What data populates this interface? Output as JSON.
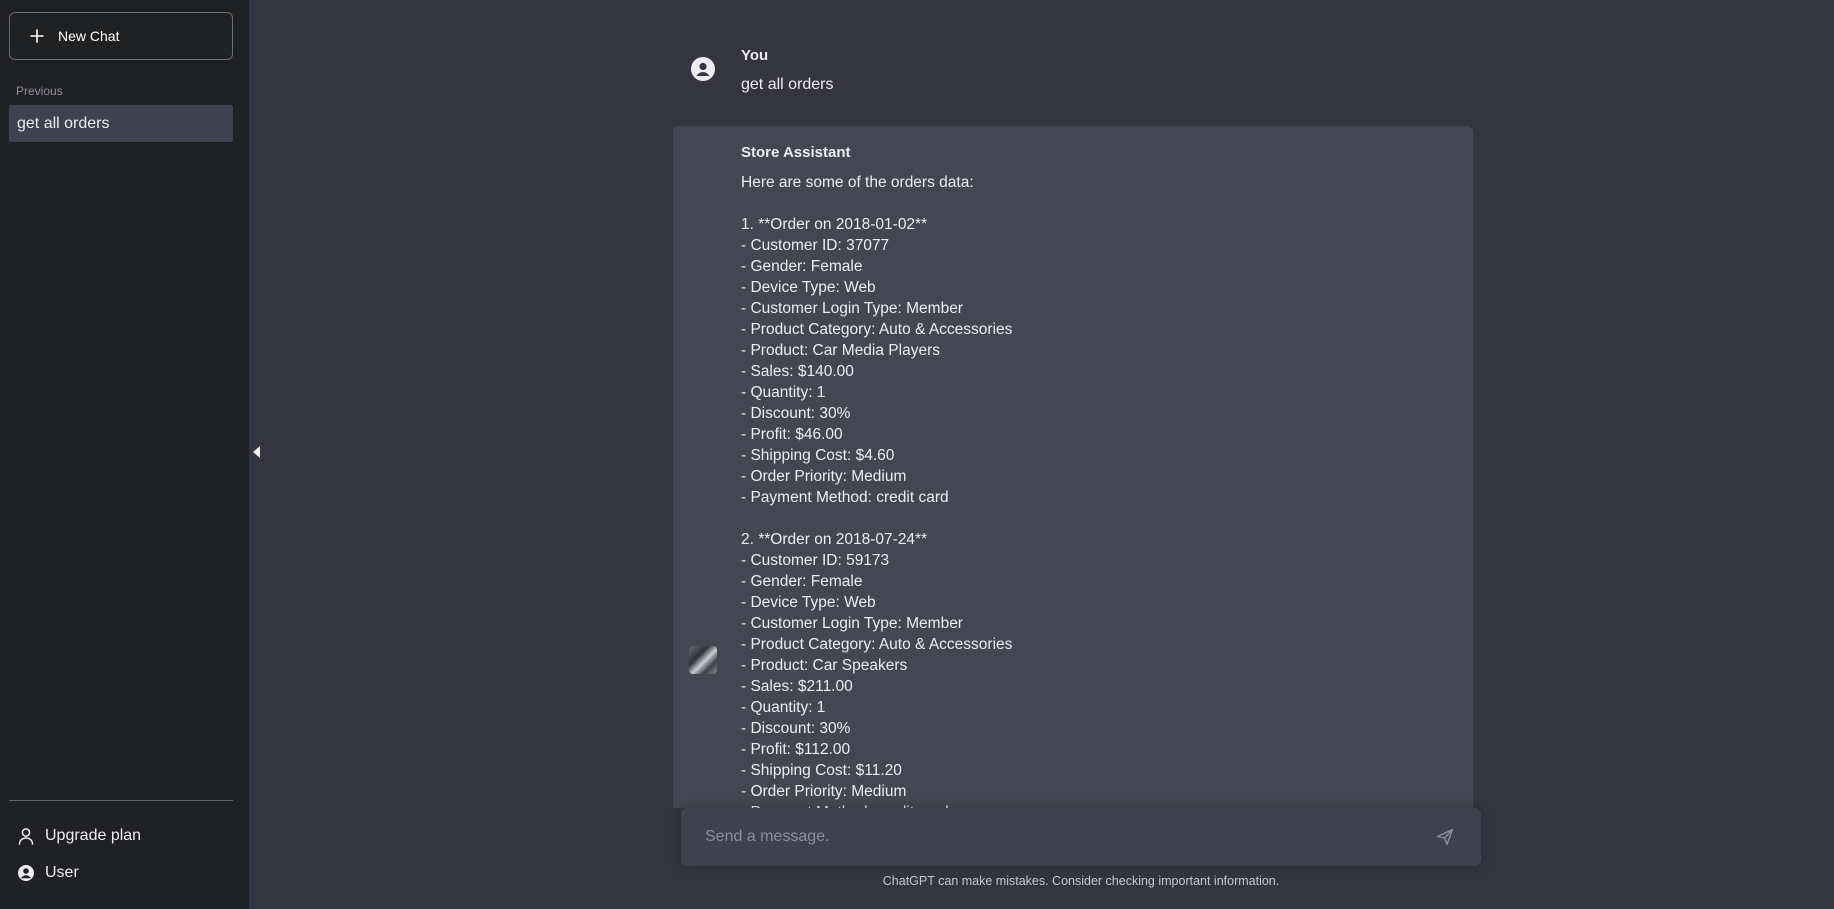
{
  "sidebar": {
    "new_chat_label": "New Chat",
    "section_label": "Previous",
    "history": [
      {
        "label": "get all orders"
      }
    ],
    "upgrade_label": "Upgrade plan",
    "user_label": "User"
  },
  "chat": {
    "user_message": {
      "name": "You",
      "text": "get all orders"
    },
    "assistant_message": {
      "name": "Store Assistant",
      "intro": "Here are some of the orders data:",
      "orders": [
        {
          "heading": "1. **Order on 2018-01-02**",
          "lines": [
            "- Customer ID: 37077",
            "- Gender: Female",
            "- Device Type: Web",
            "- Customer Login Type: Member",
            "- Product Category: Auto & Accessories",
            "- Product: Car Media Players",
            "- Sales: $140.00",
            "- Quantity: 1",
            "- Discount: 30%",
            "- Profit: $46.00",
            "- Shipping Cost: $4.60",
            "- Order Priority: Medium",
            "- Payment Method: credit card"
          ]
        },
        {
          "heading": "2. **Order on 2018-07-24**",
          "lines": [
            "- Customer ID: 59173",
            "- Gender: Female",
            "- Device Type: Web",
            "- Customer Login Type: Member",
            "- Product Category: Auto & Accessories",
            "- Product: Car Speakers",
            "- Sales: $211.00",
            "- Quantity: 1",
            "- Discount: 30%",
            "- Profit: $112.00",
            "- Shipping Cost: $11.20",
            "- Order Priority: Medium",
            "- Payment Method: credit card"
          ]
        }
      ]
    }
  },
  "composer": {
    "placeholder": "Send a message."
  },
  "footer": {
    "disclaimer": "ChatGPT can make mistakes. Consider checking important information."
  },
  "icons": {
    "new_chat": "plus-icon",
    "upgrade": "person-icon",
    "user": "user-circle-icon",
    "send": "send-icon",
    "collapse": "chevron-left-icon"
  }
}
